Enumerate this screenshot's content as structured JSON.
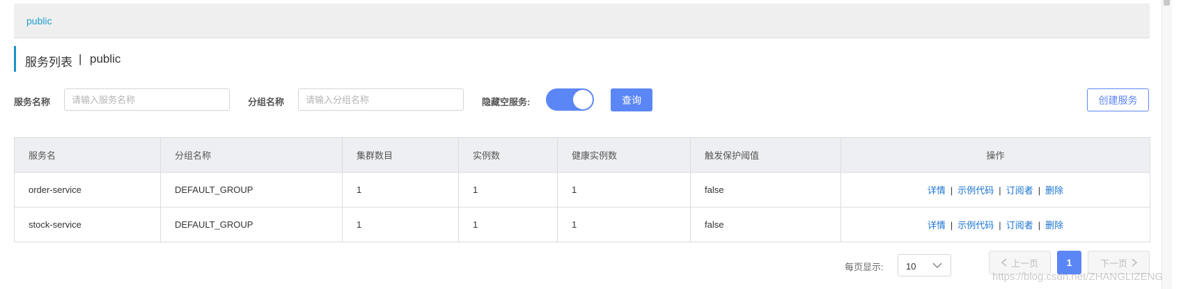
{
  "namespace_bar": {
    "label": "public"
  },
  "page": {
    "title": "服务列表",
    "separator": "|",
    "namespace": "public"
  },
  "filters": {
    "service_name_label": "服务名称",
    "service_name_placeholder": "请输入服务名称",
    "group_name_label": "分组名称",
    "group_name_placeholder": "请输入分组名称",
    "hide_empty_label": "隐藏空服务:",
    "hide_empty_on": true,
    "query_button": "查询",
    "create_button": "创建服务"
  },
  "table": {
    "headers": [
      "服务名",
      "分组名称",
      "集群数目",
      "实例数",
      "健康实例数",
      "触发保护阈值",
      "操作"
    ],
    "rows": [
      {
        "service": "order-service",
        "group": "DEFAULT_GROUP",
        "clusters": "1",
        "instances": "1",
        "healthy": "1",
        "threshold": "false"
      },
      {
        "service": "stock-service",
        "group": "DEFAULT_GROUP",
        "clusters": "1",
        "instances": "1",
        "healthy": "1",
        "threshold": "false"
      }
    ],
    "ops": {
      "detail": "详情",
      "sample_code": "示例代码",
      "subscribers": "订阅者",
      "delete": "删除",
      "sep": "|"
    }
  },
  "pagination": {
    "per_page_label": "每页显示:",
    "per_page_value": "10",
    "prev": "上一页",
    "current": "1",
    "next": "下一页"
  },
  "watermark": "https://blog.csdn.net/ZHANGLIZENG",
  "colors": {
    "primary": "#5b86f5",
    "link": "#1a73d0",
    "title_accent": "#1a93c8"
  }
}
